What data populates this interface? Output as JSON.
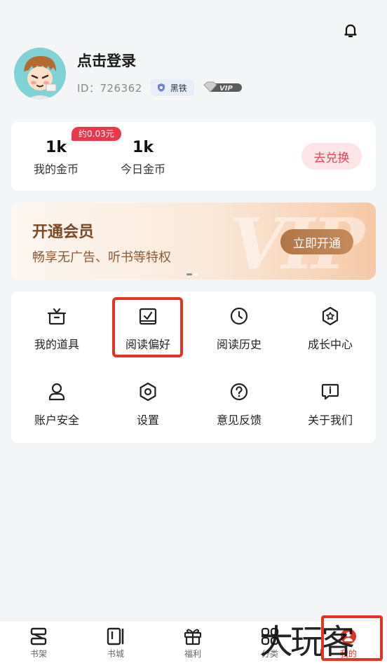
{
  "header": {
    "bell_icon": "bell-icon"
  },
  "profile": {
    "title": "点击登录",
    "id_text": "ID：726362",
    "rank_label": "黑铁",
    "vip_label": "VIP"
  },
  "coins": {
    "my_coins_value": "1k",
    "my_coins_label": "我的金币",
    "today_coins_value": "1k",
    "today_coins_label": "今日金币",
    "tag": "约0.03元",
    "exchange_label": "去兑换"
  },
  "vip_banner": {
    "title": "开通会员",
    "subtitle": "畅享无广告、听书等特权",
    "button": "立即开通",
    "watermark": "VIP"
  },
  "menu": [
    {
      "label": "我的道具",
      "icon": "prop-box-icon"
    },
    {
      "label": "阅读偏好",
      "icon": "preference-check-icon"
    },
    {
      "label": "阅读历史",
      "icon": "clock-icon"
    },
    {
      "label": "成长中心",
      "icon": "growth-star-icon"
    },
    {
      "label": "账户安全",
      "icon": "user-icon"
    },
    {
      "label": "设置",
      "icon": "gear-icon"
    },
    {
      "label": "意见反馈",
      "icon": "question-icon"
    },
    {
      "label": "关于我们",
      "icon": "info-message-icon"
    }
  ],
  "tabs": [
    {
      "label": "书架",
      "icon": "bookshelf-icon"
    },
    {
      "label": "书城",
      "icon": "bookstore-icon"
    },
    {
      "label": "福利",
      "icon": "gift-icon"
    },
    {
      "label": "分类",
      "icon": "category-grid-icon"
    },
    {
      "label": "我的",
      "icon": "profile-tab-icon"
    }
  ],
  "watermark_text": "大玩客",
  "colors": {
    "accent_red": "#e23324",
    "vip_brown": "#b07648"
  }
}
